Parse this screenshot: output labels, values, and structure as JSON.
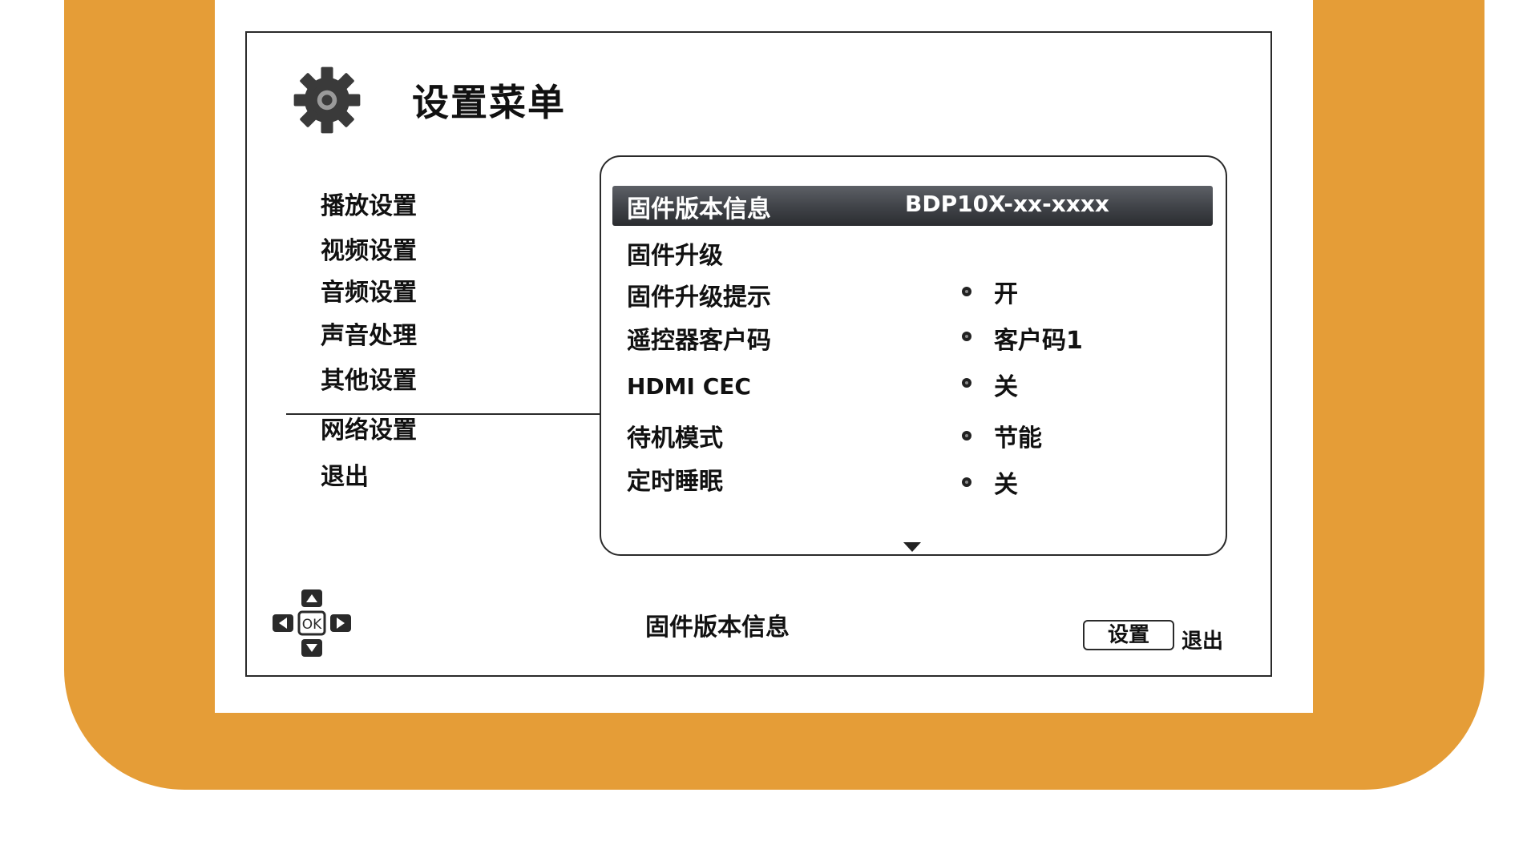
{
  "window": {
    "title": "设置菜单"
  },
  "left_menu": {
    "items": [
      {
        "label": "播放设置"
      },
      {
        "label": "视频设置"
      },
      {
        "label": "音频设置"
      },
      {
        "label": "声音处理"
      },
      {
        "label": "其他设置"
      },
      {
        "label": "网络设置"
      },
      {
        "label": "退出"
      }
    ]
  },
  "settings": {
    "rows": [
      {
        "label": "固件版本信息",
        "value": "BDP10X-xx-xxxx"
      },
      {
        "label": "固件升级",
        "value": ""
      },
      {
        "label": "固件升级提示",
        "value": "开"
      },
      {
        "label": "遥控器客户码",
        "value": "客户码1"
      },
      {
        "label": "HDMI CEC",
        "value": "关"
      },
      {
        "label": "待机模式",
        "value": "节能"
      },
      {
        "label": "定时睡眠",
        "value": "关"
      }
    ]
  },
  "footer": {
    "help_text": "固件版本信息",
    "setup_button": "设置",
    "exit_label": "退出"
  },
  "icons": {
    "settings": "gear-icon",
    "scroll_down": "down-arrow-icon",
    "navigation": "dpad-ok-icon"
  },
  "colors": {
    "bezel": "#e59d37",
    "highlight": "#3f4247",
    "text": "#111111"
  }
}
